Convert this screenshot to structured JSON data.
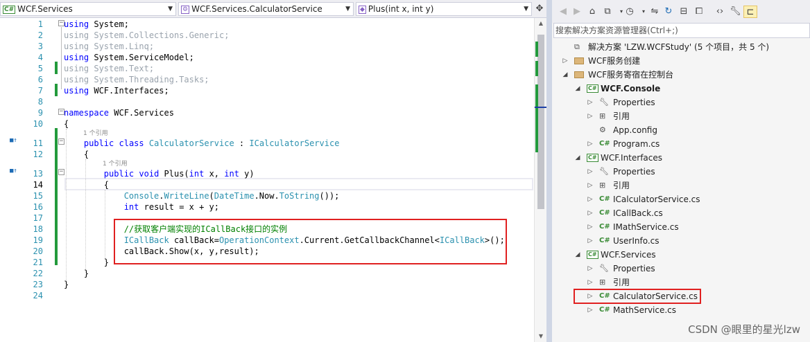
{
  "nav": {
    "project": "WCF.Services",
    "type": "WCF.Services.CalculatorService",
    "member": "Plus(int x, int y)"
  },
  "code": {
    "line_numbers": [
      "1",
      "2",
      "3",
      "4",
      "5",
      "6",
      "7",
      "8",
      "9",
      "10",
      "11",
      "12",
      "13",
      "14",
      "15",
      "16",
      "17",
      "18",
      "19",
      "20",
      "21",
      "22",
      "23",
      "24"
    ],
    "lines": [
      [
        {
          "t": "using",
          "c": "kw"
        },
        {
          "t": " System;"
        }
      ],
      [
        {
          "t": "using System.Collections.Generic;",
          "c": "gray"
        }
      ],
      [
        {
          "t": "using System.Linq;",
          "c": "gray"
        }
      ],
      [
        {
          "t": "using",
          "c": "kw"
        },
        {
          "t": " System.ServiceModel;"
        }
      ],
      [
        {
          "t": "using System.Text;",
          "c": "gray"
        }
      ],
      [
        {
          "t": "using System.Threading.Tasks;",
          "c": "gray"
        }
      ],
      [
        {
          "t": "using",
          "c": "kw"
        },
        {
          "t": " WCF.Interfaces;"
        }
      ],
      [],
      [
        {
          "t": "namespace",
          "c": "kw"
        },
        {
          "t": " WCF.Services"
        }
      ],
      [
        {
          "t": "{"
        }
      ],
      [
        {
          "t": "    "
        },
        {
          "t": "public",
          "c": "kw"
        },
        {
          "t": " "
        },
        {
          "t": "class",
          "c": "kw"
        },
        {
          "t": " "
        },
        {
          "t": "CalculatorService",
          "c": "ty"
        },
        {
          "t": " : "
        },
        {
          "t": "ICalculatorService",
          "c": "ty"
        }
      ],
      [
        {
          "t": "    {"
        }
      ],
      [
        {
          "t": "        "
        },
        {
          "t": "public",
          "c": "kw"
        },
        {
          "t": " "
        },
        {
          "t": "void",
          "c": "kw"
        },
        {
          "t": " Plus("
        },
        {
          "t": "int",
          "c": "kw"
        },
        {
          "t": " x, "
        },
        {
          "t": "int",
          "c": "kw"
        },
        {
          "t": " y)"
        }
      ],
      [
        {
          "t": "        {"
        }
      ],
      [
        {
          "t": "            "
        },
        {
          "t": "Console",
          "c": "ty"
        },
        {
          "t": "."
        },
        {
          "t": "WriteLine",
          "c": "fd"
        },
        {
          "t": "("
        },
        {
          "t": "DateTime",
          "c": "ty"
        },
        {
          "t": ".Now."
        },
        {
          "t": "ToString",
          "c": "fd"
        },
        {
          "t": "());"
        }
      ],
      [
        {
          "t": "            "
        },
        {
          "t": "int",
          "c": "kw"
        },
        {
          "t": " result = x + y;"
        }
      ],
      [],
      [
        {
          "t": "            "
        },
        {
          "t": "//获取客户端实现的ICallBack接口的实例",
          "c": "cm"
        }
      ],
      [
        {
          "t": "            "
        },
        {
          "t": "ICallBack",
          "c": "ty"
        },
        {
          "t": " callBack="
        },
        {
          "t": "OperationContext",
          "c": "ty"
        },
        {
          "t": ".Current.GetCallbackChannel<"
        },
        {
          "t": "ICallBack",
          "c": "ty"
        },
        {
          "t": ">();"
        }
      ],
      [
        {
          "t": "            callBack.Show(x, y,result);"
        }
      ],
      [
        {
          "t": "        }"
        }
      ],
      [
        {
          "t": "    }"
        }
      ],
      [
        {
          "t": "}"
        }
      ],
      []
    ],
    "lens_text": "1 个引用"
  },
  "explorer": {
    "search_placeholder": "搜索解决方案资源管理器(Ctrl+;)",
    "items": [
      {
        "label": "解决方案 'LZW.WCFStudy' (5 个项目，共 5 个)",
        "icon": "solution-icon",
        "depth": 0,
        "expander": ""
      },
      {
        "label": "WCF服务创建",
        "icon": "folder-icon",
        "depth": 0,
        "expander": "▷"
      },
      {
        "label": "WCF服务寄宿在控制台",
        "icon": "folder-icon",
        "depth": 0,
        "expander": "◢"
      },
      {
        "label": "WCF.Console",
        "icon": "csproj-icon",
        "depth": 1,
        "expander": "◢",
        "bold": true
      },
      {
        "label": "Properties",
        "icon": "wrench-icon",
        "depth": 2,
        "expander": "▷"
      },
      {
        "label": "引用",
        "icon": "references-icon",
        "depth": 2,
        "expander": "▷"
      },
      {
        "label": "App.config",
        "icon": "config-icon",
        "depth": 2,
        "expander": ""
      },
      {
        "label": "Program.cs",
        "icon": "csharp-file-icon",
        "depth": 2,
        "expander": "▷"
      },
      {
        "label": "WCF.Interfaces",
        "icon": "csproj-icon",
        "depth": 1,
        "expander": "◢"
      },
      {
        "label": "Properties",
        "icon": "wrench-icon",
        "depth": 2,
        "expander": "▷"
      },
      {
        "label": "引用",
        "icon": "references-icon",
        "depth": 2,
        "expander": "▷"
      },
      {
        "label": "ICalculatorService.cs",
        "icon": "csharp-file-icon",
        "depth": 2,
        "expander": "▷"
      },
      {
        "label": "ICallBack.cs",
        "icon": "csharp-file-icon",
        "depth": 2,
        "expander": "▷"
      },
      {
        "label": "IMathService.cs",
        "icon": "csharp-file-icon",
        "depth": 2,
        "expander": "▷"
      },
      {
        "label": "UserInfo.cs",
        "icon": "csharp-file-icon",
        "depth": 2,
        "expander": "▷"
      },
      {
        "label": "WCF.Services",
        "icon": "csproj-icon",
        "depth": 1,
        "expander": "◢"
      },
      {
        "label": "Properties",
        "icon": "wrench-icon",
        "depth": 2,
        "expander": "▷"
      },
      {
        "label": "引用",
        "icon": "references-icon",
        "depth": 2,
        "expander": "▷"
      },
      {
        "label": "CalculatorService.cs",
        "icon": "csharp-file-icon",
        "depth": 2,
        "expander": "▷"
      },
      {
        "label": "MathService.cs",
        "icon": "csharp-file-icon",
        "depth": 2,
        "expander": "▷"
      }
    ]
  },
  "watermark": "CSDN @眼里的星光lzw",
  "colors": {
    "keyword": "#0000ff",
    "type": "#2b91af",
    "comment": "#008000",
    "change_marker": "#239a3c",
    "highlight_box": "#e02020"
  }
}
